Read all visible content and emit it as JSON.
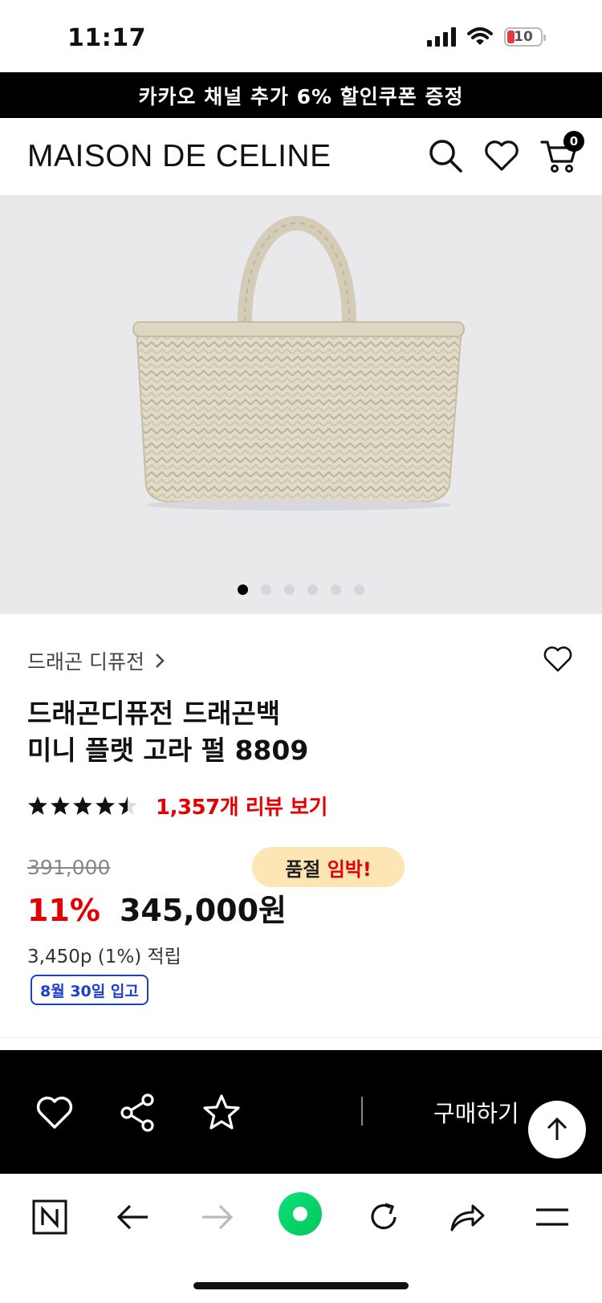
{
  "status": {
    "time": "11:17",
    "battery": "10"
  },
  "promo": {
    "text": "카카오 채널 추가 6% 할인쿠폰 증정"
  },
  "header": {
    "logo": "MAISON DE CELINE",
    "cart_count": "0"
  },
  "gallery": {
    "total": 6,
    "active_index": 0
  },
  "product": {
    "brand": "드래곤 디퓨전",
    "title_line1": "드래곤디퓨전 드래곤백",
    "title_line2": "미니 플랫 고라 펄 8809",
    "rating": 4.5,
    "review_link": "1,357개 리뷰 보기",
    "original_price": "391,000",
    "soldout_prefix": "품절 ",
    "soldout_highlight": "임박!",
    "discount": "11%",
    "price": "345,000원",
    "points": "3,450p (1%) 적립",
    "arrival": "8월 30일 입고"
  },
  "action_bar": {
    "buy_label": "구매하기"
  },
  "colors": {
    "accent_red": "#e40000",
    "badge_blue": "#1c3fd1",
    "soldout_bg": "#fde6b4",
    "naver_green": "#03c75a"
  }
}
